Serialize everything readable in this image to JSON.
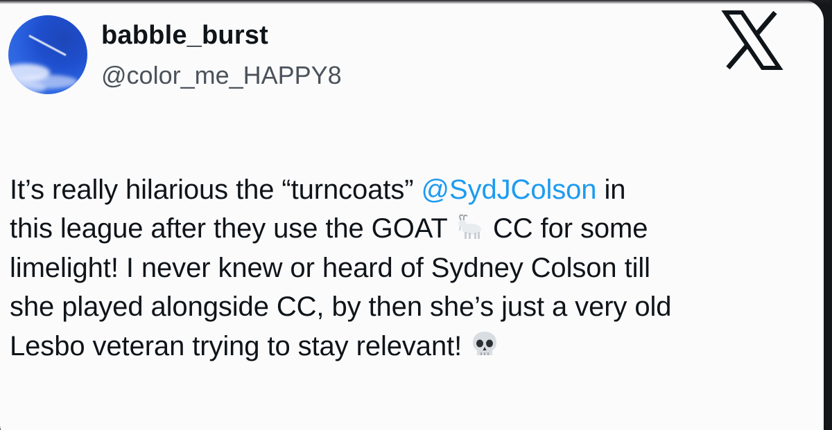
{
  "author": {
    "display_name": "babble_burst",
    "handle": "@color_me_HAPPY8"
  },
  "brand": {
    "logo_icon": "x-logo-icon",
    "logo_color": "#0f1419"
  },
  "tweet": {
    "line1_a": "It’s really hilarious the “turncoats” ",
    "mention": "@SydJColson",
    "line1_b": " in",
    "line2_a": "this league after they use the GOAT ",
    "goat_icon": "goat-emoji-icon",
    "line2_b": " CC for some",
    "line3": "limelight! I never knew or heard of Sydney Colson till",
    "line4": "she played alongside CC, by then she’s just a very old",
    "line5": "Lesbo veteran trying to stay relevant! ",
    "skull_icon": "skull-emoji-icon"
  },
  "colors": {
    "text": "#0f1419",
    "secondary_text": "#4a525a",
    "mention": "#1d9bf0",
    "card_background": "#fbfbfc"
  }
}
